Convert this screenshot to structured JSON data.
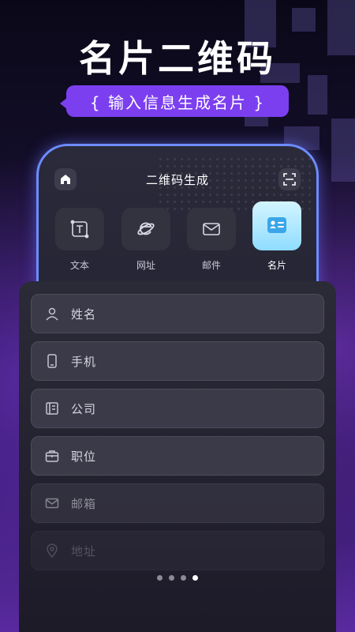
{
  "headline": "名片二维码",
  "subtitle": "{ 输入信息生成名片 }",
  "phone": {
    "title": "二维码生成",
    "left_icon": "home-icon",
    "right_icon": "scan-icon"
  },
  "types": [
    {
      "label": "文本",
      "icon": "text-icon"
    },
    {
      "label": "网址",
      "icon": "browser-icon"
    },
    {
      "label": "邮件",
      "icon": "mail-icon"
    },
    {
      "label": "名片",
      "icon": "card-icon",
      "active": true
    }
  ],
  "fields": [
    {
      "placeholder": "姓名",
      "icon": "person-icon"
    },
    {
      "placeholder": "手机",
      "icon": "phone-icon"
    },
    {
      "placeholder": "公司",
      "icon": "company-icon"
    },
    {
      "placeholder": "职位",
      "icon": "briefcase-icon"
    },
    {
      "placeholder": "邮箱",
      "icon": "mail-icon"
    },
    {
      "placeholder": "地址",
      "icon": "location-icon"
    }
  ],
  "pager": {
    "count": 4,
    "active": 4
  },
  "colors": {
    "accent": "#7c3ff0",
    "phone_border": "#6d8cff",
    "active_tab": "#8fdcff"
  }
}
